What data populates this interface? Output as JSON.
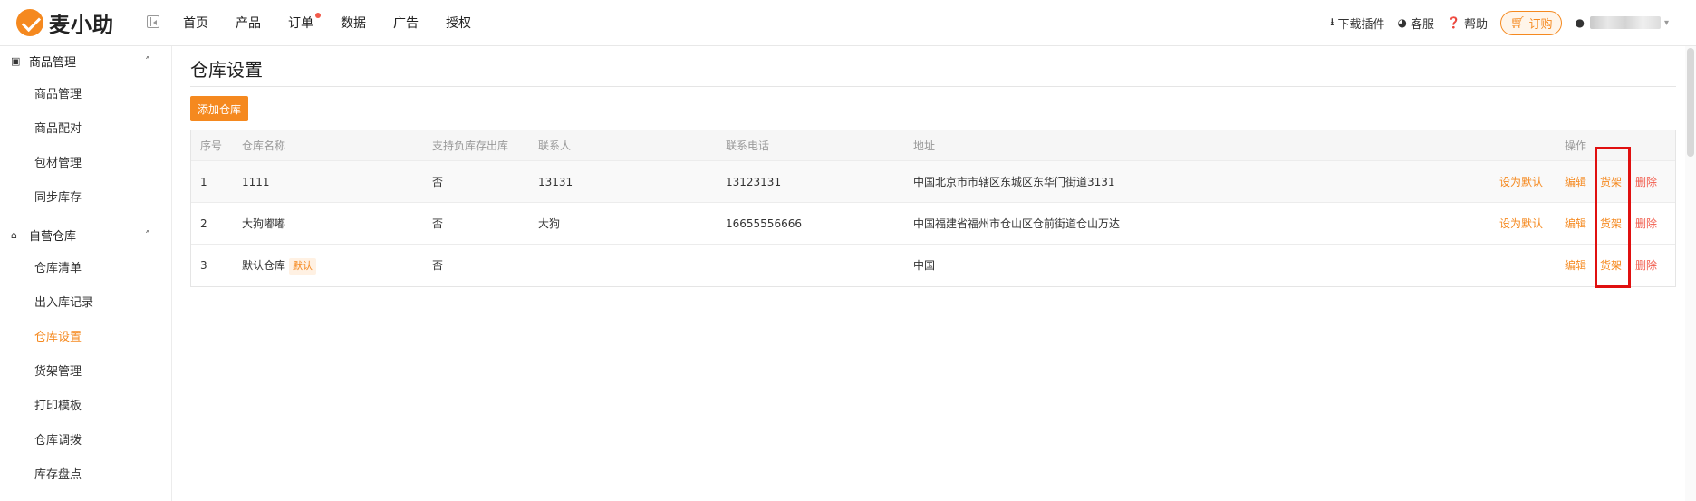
{
  "app": {
    "logo_text": "麦小助",
    "nav": [
      {
        "label": "首页"
      },
      {
        "label": "产品"
      },
      {
        "label": "订单",
        "badge_dot": true
      },
      {
        "label": "数据"
      },
      {
        "label": "广告"
      },
      {
        "label": "授权"
      }
    ],
    "top_right": {
      "download_label": "下载插件",
      "service_label": "客服",
      "help_label": "帮助",
      "order_label": "订购"
    },
    "accent_color": "#f5891f",
    "danger_color": "#f15a4a"
  },
  "sidebar": {
    "groups": [
      {
        "label": "商品管理",
        "icon": "product-icon",
        "items": [
          {
            "label": "商品管理"
          },
          {
            "label": "商品配对"
          },
          {
            "label": "包材管理"
          },
          {
            "label": "同步库存"
          }
        ]
      },
      {
        "label": "自营仓库",
        "icon": "home-icon",
        "items": [
          {
            "label": "仓库清单"
          },
          {
            "label": "出入库记录"
          },
          {
            "label": "仓库设置",
            "active": true
          },
          {
            "label": "货架管理"
          },
          {
            "label": "打印模板"
          },
          {
            "label": "仓库调拨"
          },
          {
            "label": "库存盘点"
          }
        ]
      }
    ]
  },
  "main": {
    "title": "仓库设置",
    "add_button": "添加仓库",
    "table": {
      "headers": {
        "index": "序号",
        "name": "仓库名称",
        "negative": "支持负库存出库",
        "contact": "联系人",
        "phone": "联系电话",
        "address": "地址",
        "actions": "操作"
      },
      "rows": [
        {
          "index": "1",
          "name": "1111",
          "tag": "",
          "negative": "否",
          "contact": "13131",
          "phone": "13123131",
          "address": "中国北京市市辖区东城区东华门街道3131",
          "set_default": "设为默认",
          "edit": "编辑",
          "shelf": "货架",
          "delete": "删除"
        },
        {
          "index": "2",
          "name": "大狗嘟嘟",
          "tag": "",
          "negative": "否",
          "contact": "大狗",
          "phone": "16655556666",
          "address": "中国福建省福州市仓山区仓前街道仓山万达",
          "set_default": "设为默认",
          "edit": "编辑",
          "shelf": "货架",
          "delete": "删除"
        },
        {
          "index": "3",
          "name": "默认仓库",
          "tag": "默认",
          "negative": "否",
          "contact": "",
          "phone": "",
          "address": "中国",
          "set_default": "",
          "edit": "编辑",
          "shelf": "货架",
          "delete": "删除"
        }
      ]
    }
  }
}
